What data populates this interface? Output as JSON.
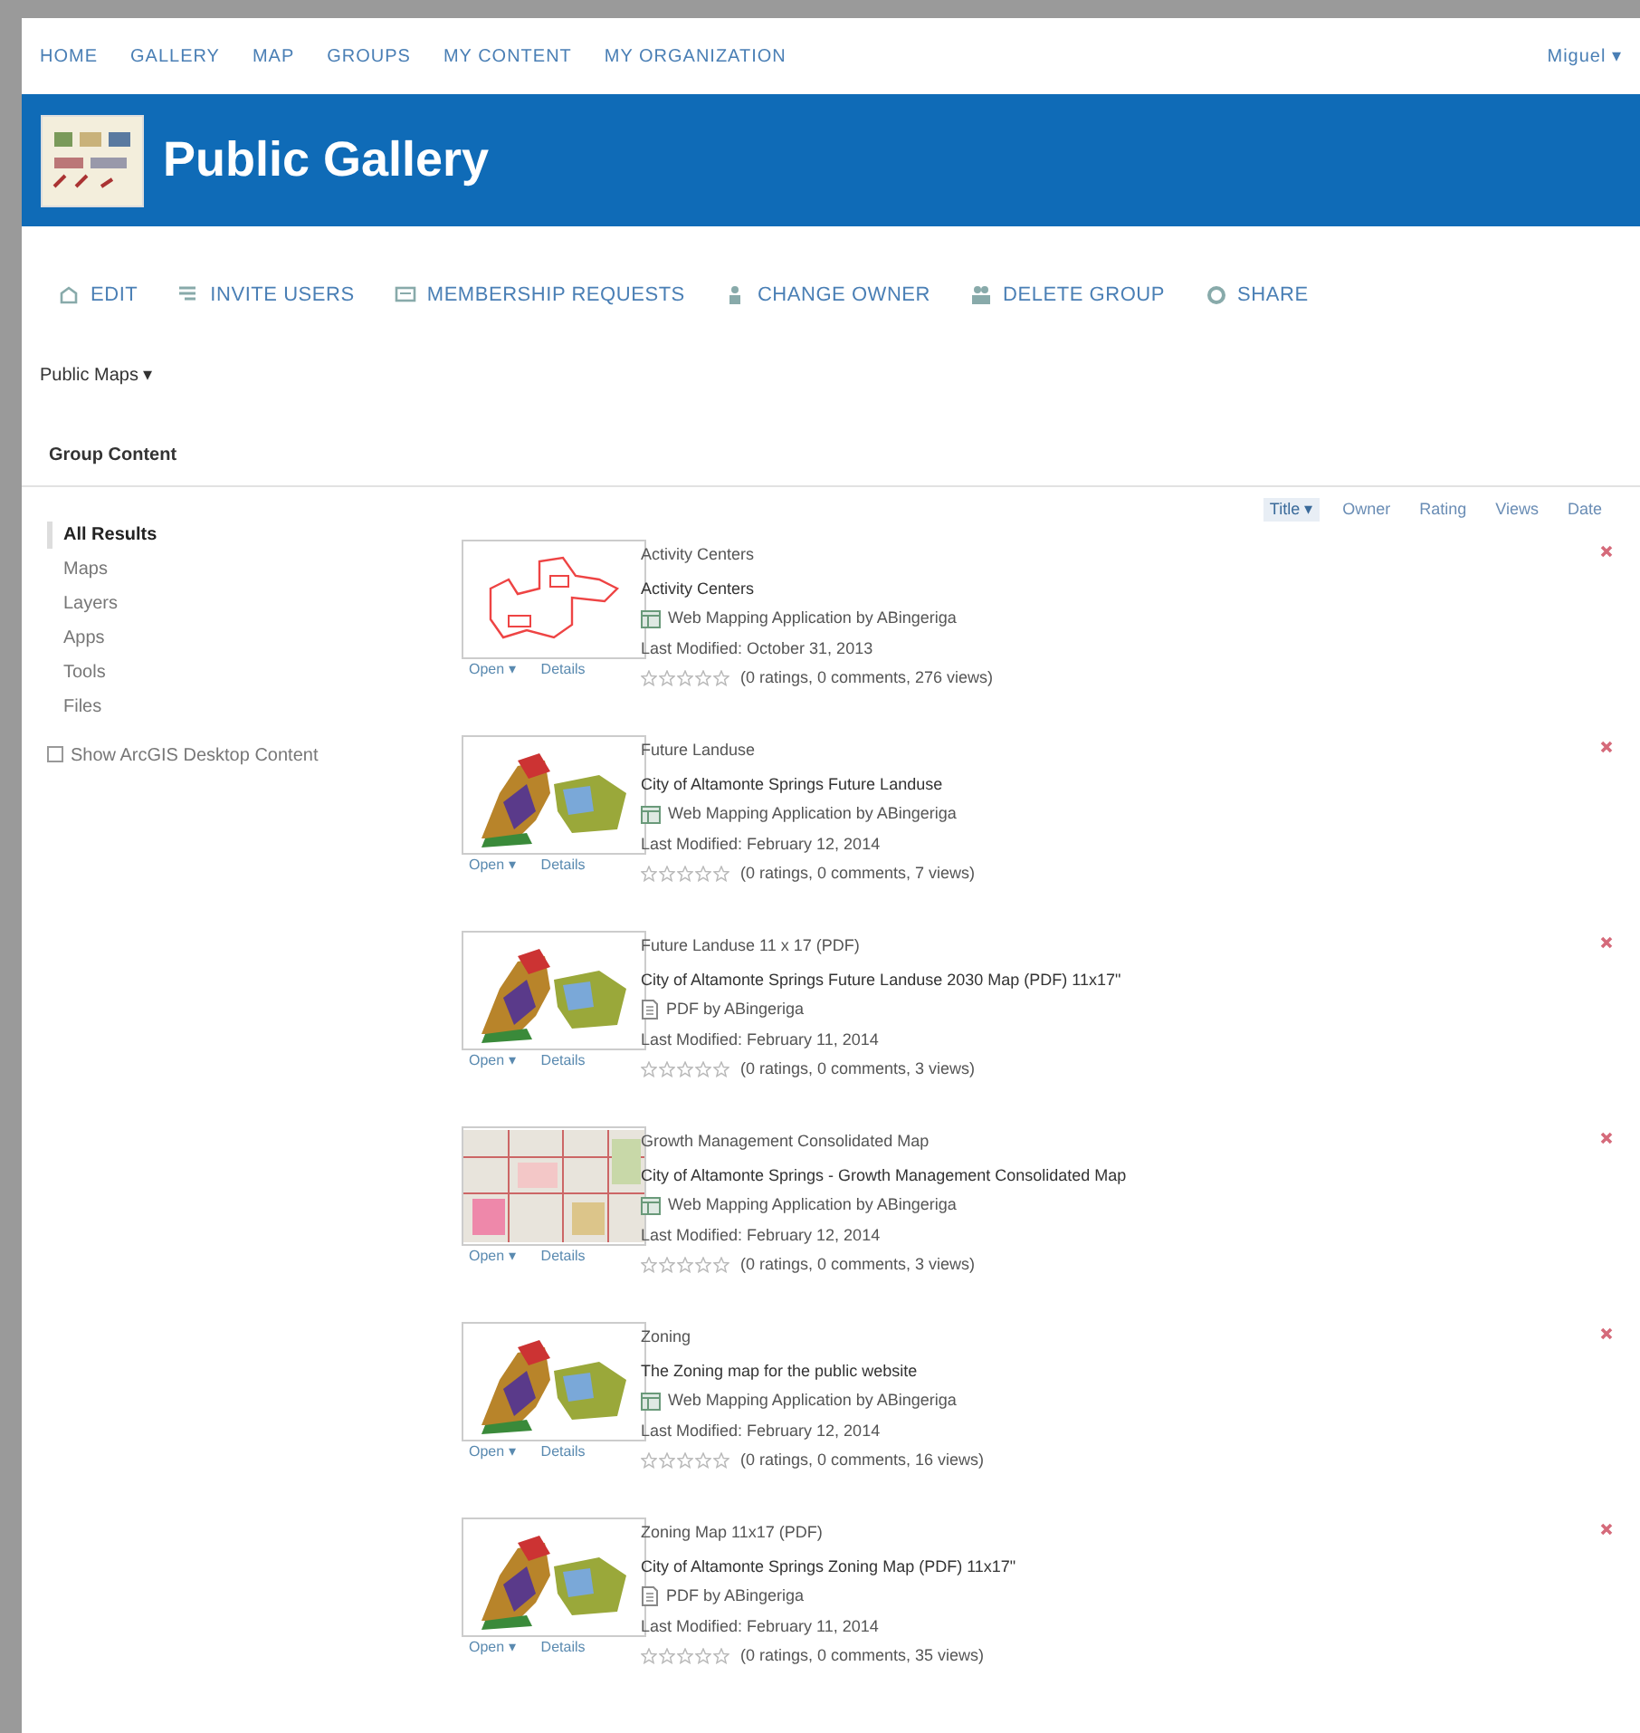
{
  "nav": {
    "items": [
      {
        "label": "HOME"
      },
      {
        "label": "GALLERY"
      },
      {
        "label": "MAP"
      },
      {
        "label": "GROUPS"
      },
      {
        "label": "MY CONTENT"
      },
      {
        "label": "MY ORGANIZATION"
      }
    ],
    "user": "Miguel ▾"
  },
  "banner": {
    "title": "Public Gallery"
  },
  "toolbar": [
    {
      "label": "EDIT",
      "kind": "edit"
    },
    {
      "label": "INVITE USERS",
      "kind": "invite"
    },
    {
      "label": "MEMBERSHIP REQUESTS",
      "kind": "requests"
    },
    {
      "label": "CHANGE OWNER",
      "kind": "owner"
    },
    {
      "label": "DELETE GROUP",
      "kind": "delete"
    },
    {
      "label": "SHARE",
      "kind": "share"
    }
  ],
  "group_menu": "Public Maps ▾",
  "section_title": "Group Content",
  "sort": [
    {
      "label": "Title ▾",
      "selected": true
    },
    {
      "label": "Owner",
      "selected": false
    },
    {
      "label": "Rating",
      "selected": false
    },
    {
      "label": "Views",
      "selected": false
    },
    {
      "label": "Date",
      "selected": false
    }
  ],
  "sidebar": {
    "items": [
      {
        "label": "All Results",
        "selected": true
      },
      {
        "label": "Maps",
        "selected": false
      },
      {
        "label": "Layers",
        "selected": false
      },
      {
        "label": "Apps",
        "selected": false
      },
      {
        "label": "Tools",
        "selected": false
      },
      {
        "label": "Files",
        "selected": false
      }
    ],
    "checkbox": {
      "label": "Show ArcGIS Desktop Content",
      "checked": false
    }
  },
  "items": [
    {
      "title": "Activity Centers",
      "summary": "Activity Centers",
      "kind": "web_app",
      "type_text": "Web Mapping Application by ABingeriga",
      "modified": "Last Modified: October 31, 2013",
      "stars": 0,
      "stats": "(0 ratings, 0 comments, 276 views)",
      "thumbnail": {
        "kind": "outline"
      },
      "open": "Open ▾",
      "details": "Details"
    },
    {
      "title": "Future Landuse",
      "summary": "City of Altamonte Springs Future Landuse",
      "kind": "web_app",
      "type_text": "Web Mapping Application by ABingeriga",
      "modified": "Last Modified: February 12, 2014",
      "stars": 0,
      "stats": "(0 ratings, 0 comments, 7 views)",
      "thumbnail": {
        "kind": "color"
      },
      "open": "Open ▾",
      "details": "Details"
    },
    {
      "title": "Future Landuse 11 x 17 (PDF)",
      "summary": "City of Altamonte Springs Future Landuse 2030 Map (PDF) 11x17\"",
      "kind": "pdf",
      "type_text": "PDF by ABingeriga",
      "modified": "Last Modified: February 11, 2014",
      "stars": 0,
      "stats": "(0 ratings, 0 comments, 3 views)",
      "thumbnail": {
        "kind": "color"
      },
      "open": "Open ▾",
      "details": "Details"
    },
    {
      "title": "Growth Management Consolidated Map",
      "summary": "City of Altamonte Springs - Growth Management Consolidated Map",
      "kind": "web_app",
      "type_text": "Web Mapping Application by ABingeriga",
      "modified": "Last Modified: February 12, 2014",
      "stars": 0,
      "stats": "(0 ratings, 0 comments, 3 views)",
      "thumbnail": {
        "kind": "parcels"
      },
      "open": "Open ▾",
      "details": "Details"
    },
    {
      "title": "Zoning",
      "summary": "The Zoning map for the public website",
      "kind": "web_app",
      "type_text": "Web Mapping Application by ABingeriga",
      "modified": "Last Modified: February 12, 2014",
      "stars": 0,
      "stats": "(0 ratings, 0 comments, 16 views)",
      "thumbnail": {
        "kind": "color"
      },
      "open": "Open ▾",
      "details": "Details"
    },
    {
      "title": "Zoning Map 11x17 (PDF)",
      "summary": "City of Altamonte Springs Zoning Map (PDF) 11x17\"",
      "kind": "pdf",
      "type_text": "PDF by ABingeriga",
      "modified": "Last Modified: February 11, 2014",
      "stars": 0,
      "stats": "(0 ratings, 0 comments, 35 views)",
      "thumbnail": {
        "kind": "color"
      },
      "open": "Open ▾",
      "details": "Details"
    }
  ]
}
